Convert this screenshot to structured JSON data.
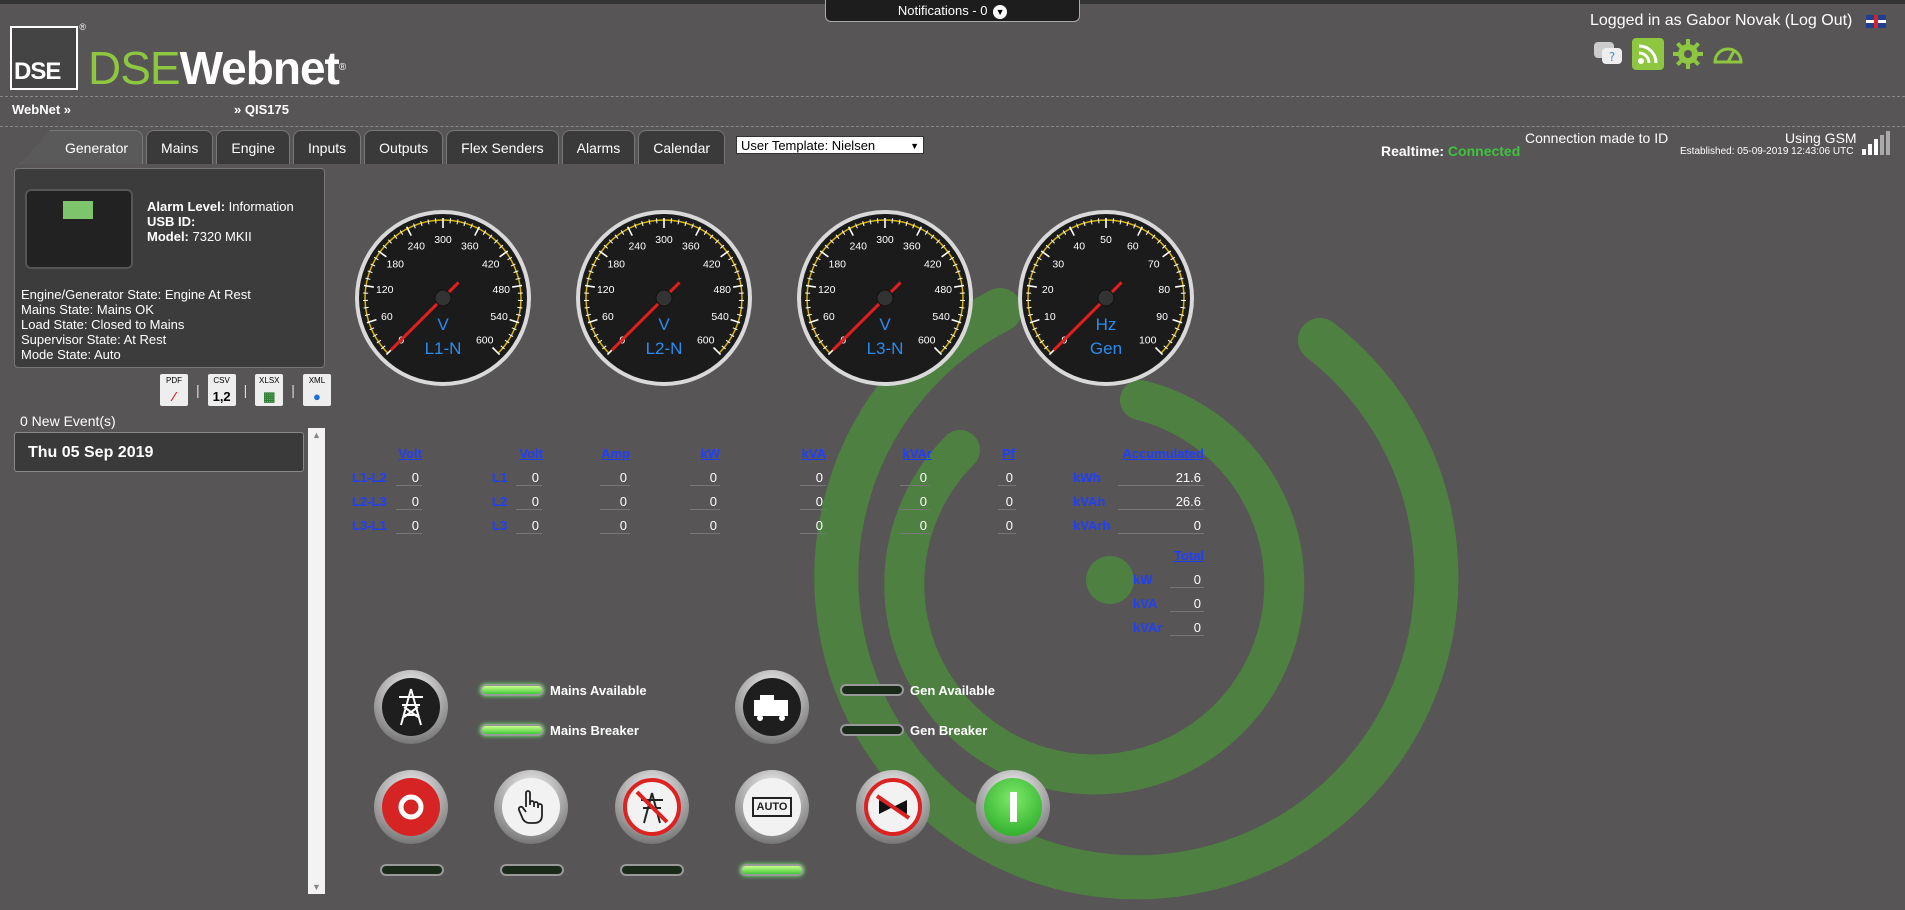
{
  "header": {
    "notifications": "Notifications - 0",
    "logo_text": "DSE",
    "brand_dse": "DSE",
    "brand_web": "Webnet",
    "login_text": "Logged in as Gabor Novak (Log Out)"
  },
  "breadcrumbs": {
    "root": "WebNet »",
    "site": "» QIS175"
  },
  "tabs": [
    "Generator",
    "Mains",
    "Engine",
    "Inputs",
    "Outputs",
    "Flex Senders",
    "Alarms",
    "Calendar"
  ],
  "template_select": "User Template: Nielsen",
  "status": {
    "realtime_label": "Realtime:",
    "realtime_value": "Connected",
    "connection": "Connection made to ID",
    "using": "Using GSM",
    "established": "Established: 05-09-2019 12:43:06 UTC"
  },
  "device": {
    "alarm_label": "Alarm Level:",
    "alarm_value": "Information",
    "usb_label": "USB ID:",
    "model_label": "Model:",
    "model_value": "7320 MKII",
    "states": [
      "Engine/Generator State: Engine At Rest",
      "Mains State: Mains OK",
      "Load State: Closed to Mains",
      "Supervisor State: At Rest",
      "Mode State: Auto"
    ]
  },
  "exports": [
    {
      "tag": "PDF",
      "mark": "⁄"
    },
    {
      "tag": "CSV",
      "mark": "1,2"
    },
    {
      "tag": "XLSX",
      "mark": "▦"
    },
    {
      "tag": "XML",
      "mark": "●"
    }
  ],
  "events": {
    "new": "0 New Event(s)",
    "date": "Thu 05 Sep 2019"
  },
  "gauges": [
    {
      "unit": "V",
      "label": "L1-N",
      "ticks": [
        "0",
        "60",
        "120",
        "180",
        "240",
        "300",
        "360",
        "420",
        "480",
        "540",
        "600"
      ],
      "max": 600,
      "value": 0
    },
    {
      "unit": "V",
      "label": "L2-N",
      "ticks": [
        "0",
        "60",
        "120",
        "180",
        "240",
        "300",
        "360",
        "420",
        "480",
        "540",
        "600"
      ],
      "max": 600,
      "value": 0
    },
    {
      "unit": "V",
      "label": "L3-N",
      "ticks": [
        "0",
        "60",
        "120",
        "180",
        "240",
        "300",
        "360",
        "420",
        "480",
        "540",
        "600"
      ],
      "max": 600,
      "value": 0
    },
    {
      "unit": "Hz",
      "label": "Gen",
      "ticks": [
        "0",
        "10",
        "20",
        "30",
        "40",
        "50",
        "60",
        "70",
        "80",
        "90",
        "100"
      ],
      "max": 100,
      "value": 0
    }
  ],
  "table": {
    "headers": [
      "Volt",
      "Volt",
      "Amp",
      "kW",
      "kVA",
      "kVAr",
      "Pf",
      "Accumulated",
      "Total"
    ],
    "ll_labels": [
      "L1-L2",
      "L2-L3",
      "L3-L1"
    ],
    "ln_labels": [
      "L1",
      "L2",
      "L3"
    ],
    "ll_volt": [
      "0",
      "0",
      "0"
    ],
    "ln_volt": [
      "0",
      "0",
      "0"
    ],
    "amp": [
      "0",
      "0",
      "0"
    ],
    "kw": [
      "0",
      "0",
      "0"
    ],
    "kva": [
      "0",
      "0",
      "0"
    ],
    "kvar": [
      "0",
      "0",
      "0"
    ],
    "pf": [
      "0",
      "0",
      "0"
    ],
    "acc_labels": [
      "kWh",
      "kVAh",
      "kVArh"
    ],
    "acc_values": [
      "21.6",
      "26.6",
      "0"
    ],
    "tot_labels": [
      "kW",
      "kVA",
      "kVAr"
    ],
    "tot_values": [
      "0",
      "0",
      "0"
    ]
  },
  "indicators": {
    "mains_available": "Mains Available",
    "mains_breaker": "Mains Breaker",
    "gen_available": "Gen Available",
    "gen_breaker": "Gen Breaker"
  },
  "controls": {
    "auto_label": "AUTO"
  },
  "colors": {
    "accent_green": "#8dc63f",
    "link_blue": "#1f3fff",
    "connected": "#3ec43e",
    "needle": "#e41e1e"
  }
}
